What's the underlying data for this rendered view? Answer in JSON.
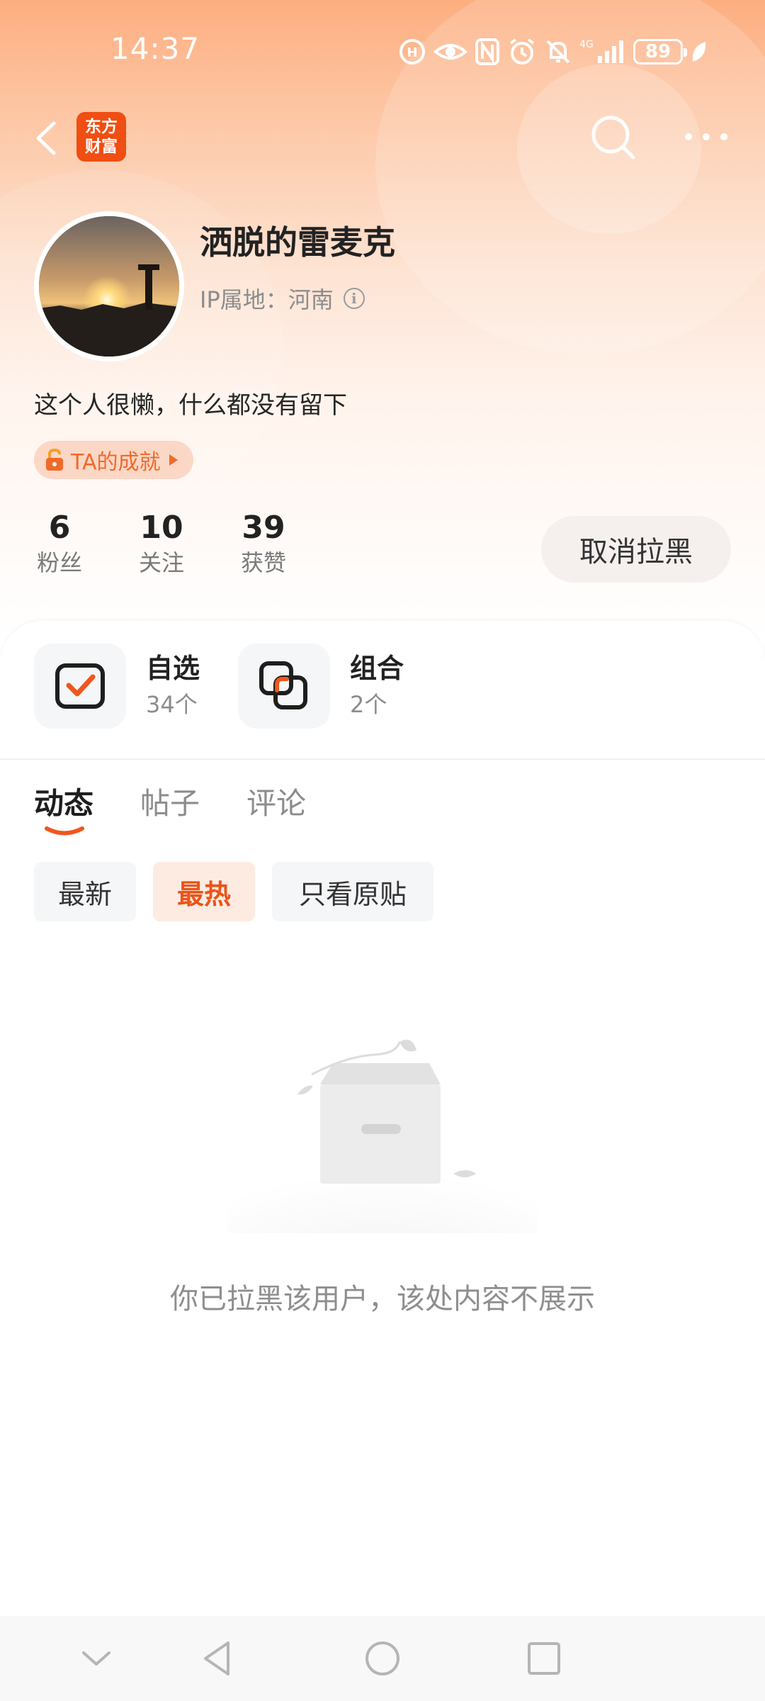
{
  "status_bar": {
    "time": "14:37",
    "network": "4G",
    "battery": "89"
  },
  "nav": {
    "logo_line1": "东方",
    "logo_line2": "财富"
  },
  "profile": {
    "username": "洒脱的雷麦克",
    "ip_label": "IP属地：河南",
    "bio": "这个人很懒，什么都没有留下",
    "achievement_label": "TA的成就"
  },
  "stats": [
    {
      "value": "6",
      "label": "粉丝"
    },
    {
      "value": "10",
      "label": "关注"
    },
    {
      "value": "39",
      "label": "获赞"
    }
  ],
  "unblock_button": "取消拉黑",
  "features": [
    {
      "title": "自选",
      "count": "34个",
      "icon": "checkbox-icon"
    },
    {
      "title": "组合",
      "count": "2个",
      "icon": "overlap-squares-icon"
    }
  ],
  "tabs": [
    {
      "label": "动态",
      "active": true
    },
    {
      "label": "帖子",
      "active": false
    },
    {
      "label": "评论",
      "active": false
    }
  ],
  "filters": [
    {
      "label": "最新",
      "active": false
    },
    {
      "label": "最热",
      "active": true
    },
    {
      "label": "只看原贴",
      "active": false
    }
  ],
  "empty_message": "你已拉黑该用户，该处内容不展示",
  "colors": {
    "accent": "#e8551a",
    "logo_bg": "#f04e12",
    "header_gradient_top": "#fdae80"
  }
}
